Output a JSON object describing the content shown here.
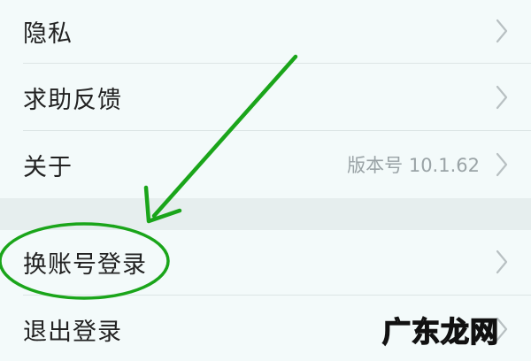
{
  "menu": {
    "items": [
      {
        "label": "隐私",
        "value": ""
      },
      {
        "label": "求助反馈",
        "value": ""
      },
      {
        "label": "关于",
        "value": "版本号 10.1.62"
      },
      {
        "label": "换账号登录",
        "value": ""
      },
      {
        "label": "退出登录",
        "value": ""
      }
    ]
  },
  "annotation": {
    "color": "#1aa51a"
  },
  "watermark": {
    "text": "广东龙网"
  }
}
